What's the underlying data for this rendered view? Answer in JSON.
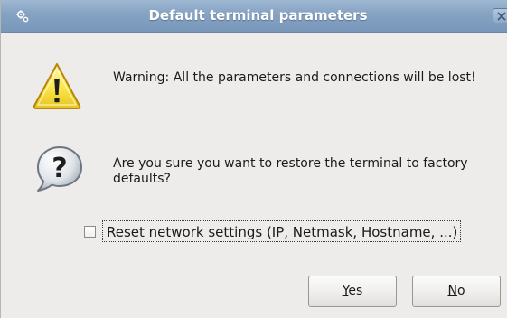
{
  "window": {
    "title": "Default terminal parameters",
    "titlebar_color": "#85a2c2",
    "menu_icon": "window-menu-icon",
    "close_icon": "close-icon"
  },
  "messages": {
    "warning": {
      "icon": "warning-icon",
      "text": "Warning: All the parameters and connections will be lost!"
    },
    "question": {
      "icon": "question-icon",
      "text": "Are you sure you want to restore the terminal to factory defaults?"
    }
  },
  "options": {
    "reset_network": {
      "label": "Reset network settings (IP, Netmask, Hostname, ...)",
      "checked": false
    }
  },
  "buttons": {
    "yes": {
      "mnemonic": "Y",
      "rest": "es"
    },
    "no": {
      "mnemonic": "N",
      "rest": "o"
    }
  }
}
